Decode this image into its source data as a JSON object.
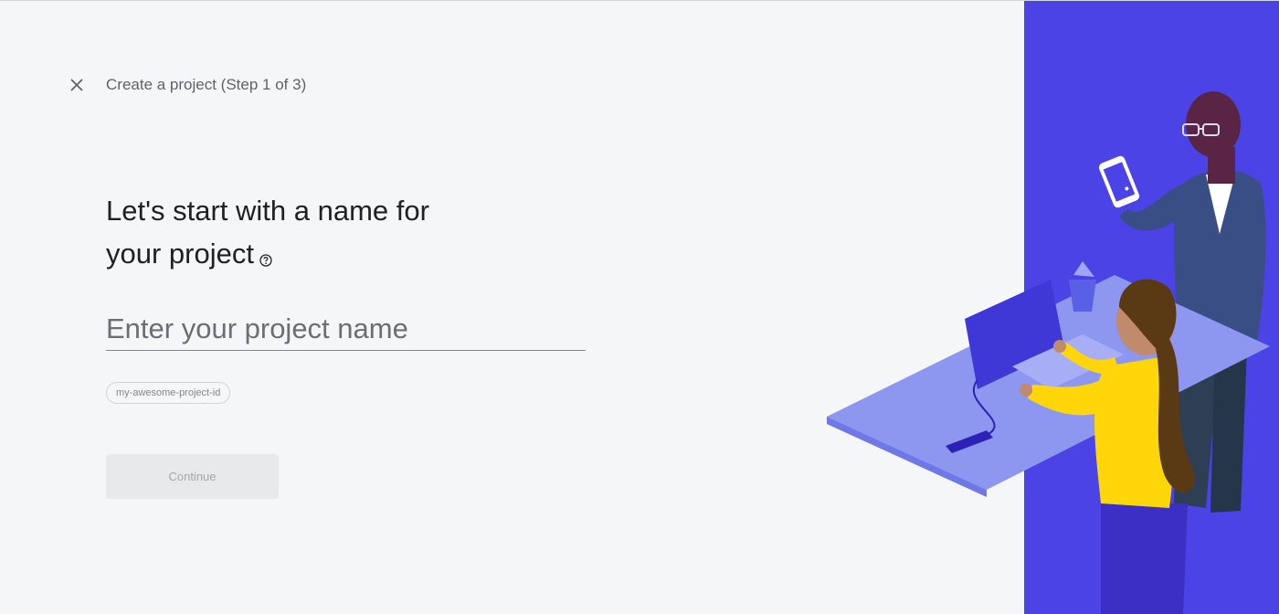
{
  "header": {
    "close_icon": "close-icon",
    "step_title": "Create a project (Step 1 of 3)"
  },
  "main": {
    "heading_line1": "Let's start with a name for",
    "heading_line2": "your project",
    "help_icon": "help-circle-icon",
    "project_name": {
      "value": "",
      "placeholder": "Enter your project name"
    },
    "project_id_chip": "my-awesome-project-id",
    "continue_label": "Continue"
  },
  "colors": {
    "background": "#f5f6f8",
    "illustration_panel": "#4b43e6",
    "heading_text": "#202124",
    "disabled_button": "#e8e9eb"
  }
}
